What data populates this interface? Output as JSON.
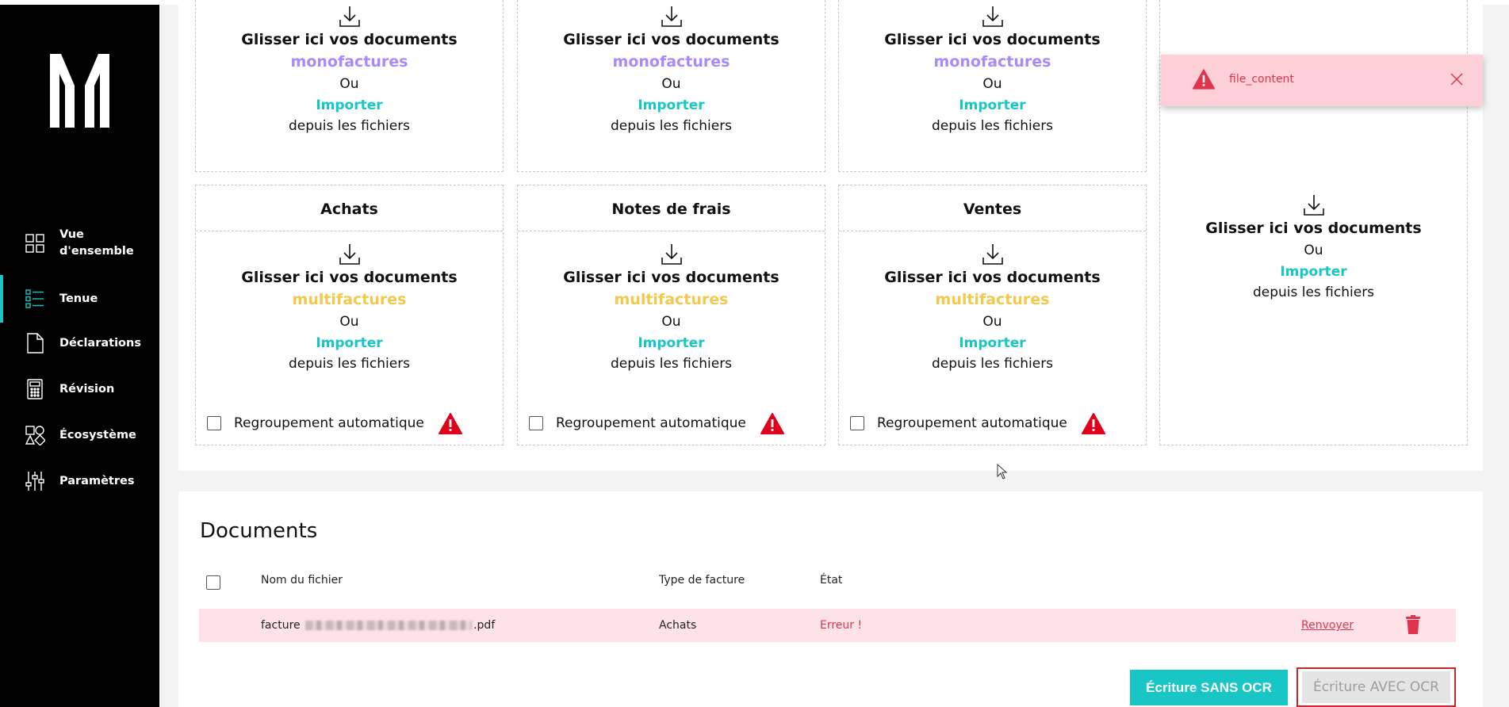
{
  "sidebar": {
    "items": [
      {
        "label": "Vue d'ensemble",
        "icon": "grid-icon"
      },
      {
        "label": "Tenue",
        "icon": "list-icon",
        "active": true
      },
      {
        "label": "Déclarations",
        "icon": "document-icon"
      },
      {
        "label": "Révision",
        "icon": "calculator-icon"
      },
      {
        "label": "Écosystème",
        "icon": "shapes-icon"
      },
      {
        "label": "Paramètres",
        "icon": "sliders-icon"
      }
    ]
  },
  "upload": {
    "drop_text": "Glisser ici vos documents",
    "mono": "monofactures",
    "multi": "multifactures",
    "or": "Ou",
    "import": "Importer",
    "from_files": "depuis les fichiers",
    "regroup": "Regroupement automatique",
    "categories": [
      "Achats",
      "Notes de frais",
      "Ventes"
    ]
  },
  "toast": {
    "message": "file_content"
  },
  "documents": {
    "title": "Documents",
    "headers": {
      "name": "Nom du fichier",
      "type": "Type de facture",
      "state": "État"
    },
    "rows": [
      {
        "name_prefix": "facture",
        "name_suffix": ".pdf",
        "type": "Achats",
        "state": "Erreur !",
        "action": "Renvoyer"
      }
    ],
    "btn_sans": "Écriture SANS OCR",
    "btn_avec": "Écriture AVEC OCR"
  },
  "colors": {
    "accent": "#19c6c6",
    "mono": "#a78bfa",
    "multi": "#f2c94c",
    "error": "#e0344e",
    "error_bg": "#fde3e7"
  }
}
